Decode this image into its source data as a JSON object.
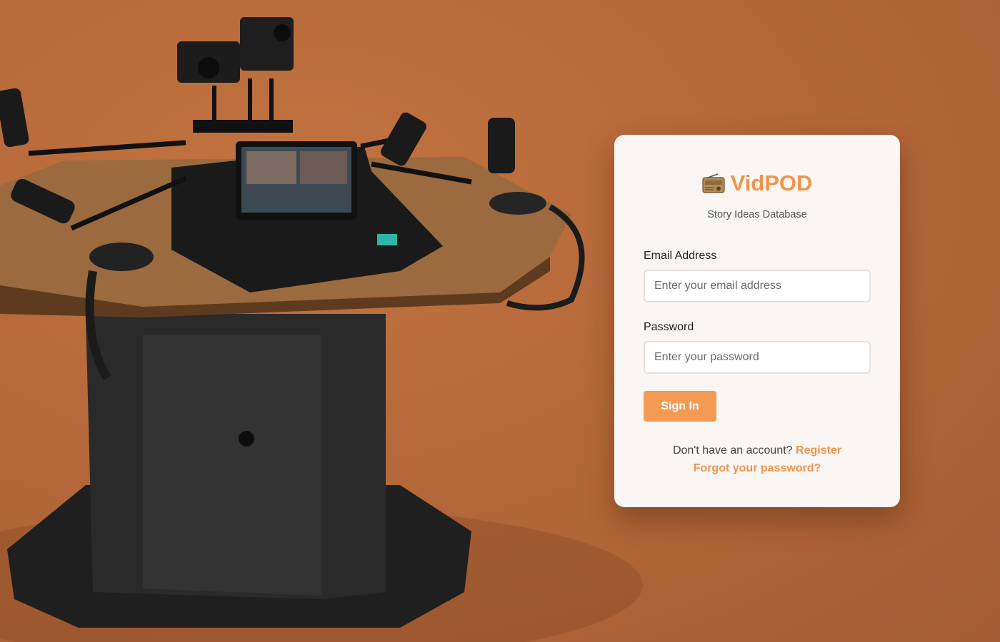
{
  "brand": {
    "icon": "radio-icon",
    "title": "VidPOD",
    "subtitle": "Story Ideas Database"
  },
  "form": {
    "email_label": "Email Address",
    "email_placeholder": "Enter your email address",
    "password_label": "Password",
    "password_placeholder": "Enter your password",
    "submit_label": "Sign In"
  },
  "footer": {
    "no_account_text": "Don't have an account?",
    "register_link": "Register",
    "forgot_link": "Forgot your password?"
  },
  "colors": {
    "background": "#b5683a",
    "accent": "#f0944e",
    "button": "#f39a55",
    "card": "#faf6f3"
  }
}
